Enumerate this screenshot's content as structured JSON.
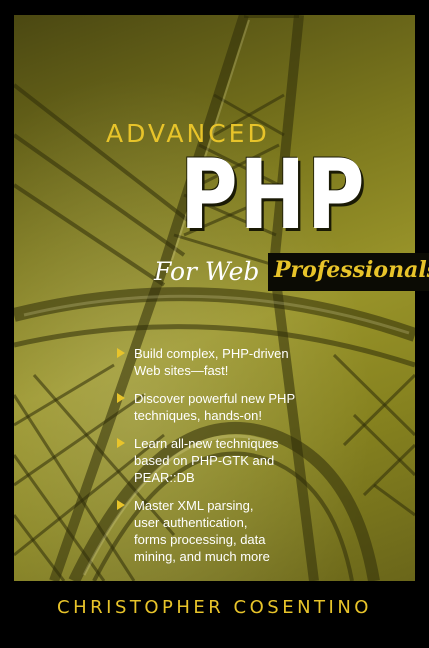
{
  "cover": {
    "title_small": "ADVANCED",
    "title_large": "PHP",
    "subtitle_part1": "For Web",
    "subtitle_part2": "Professionals",
    "bullets": [
      {
        "lines": [
          "Build complex, PHP-driven",
          "Web sites—fast!"
        ]
      },
      {
        "lines": [
          "Discover powerful new PHP",
          "techniques, hands-on!"
        ]
      },
      {
        "lines": [
          "Learn all-new techniques",
          "based on PHP-GTK and",
          "PEAR::DB"
        ]
      },
      {
        "lines": [
          "Master XML parsing,",
          "user authentication,",
          "forms processing, data",
          "mining, and much more"
        ]
      }
    ],
    "author": "CHRISTOPHER COSENTINO",
    "colors": {
      "accent_gold": "#e8c42a",
      "olive": "#8c881f",
      "background": "#000000"
    }
  }
}
